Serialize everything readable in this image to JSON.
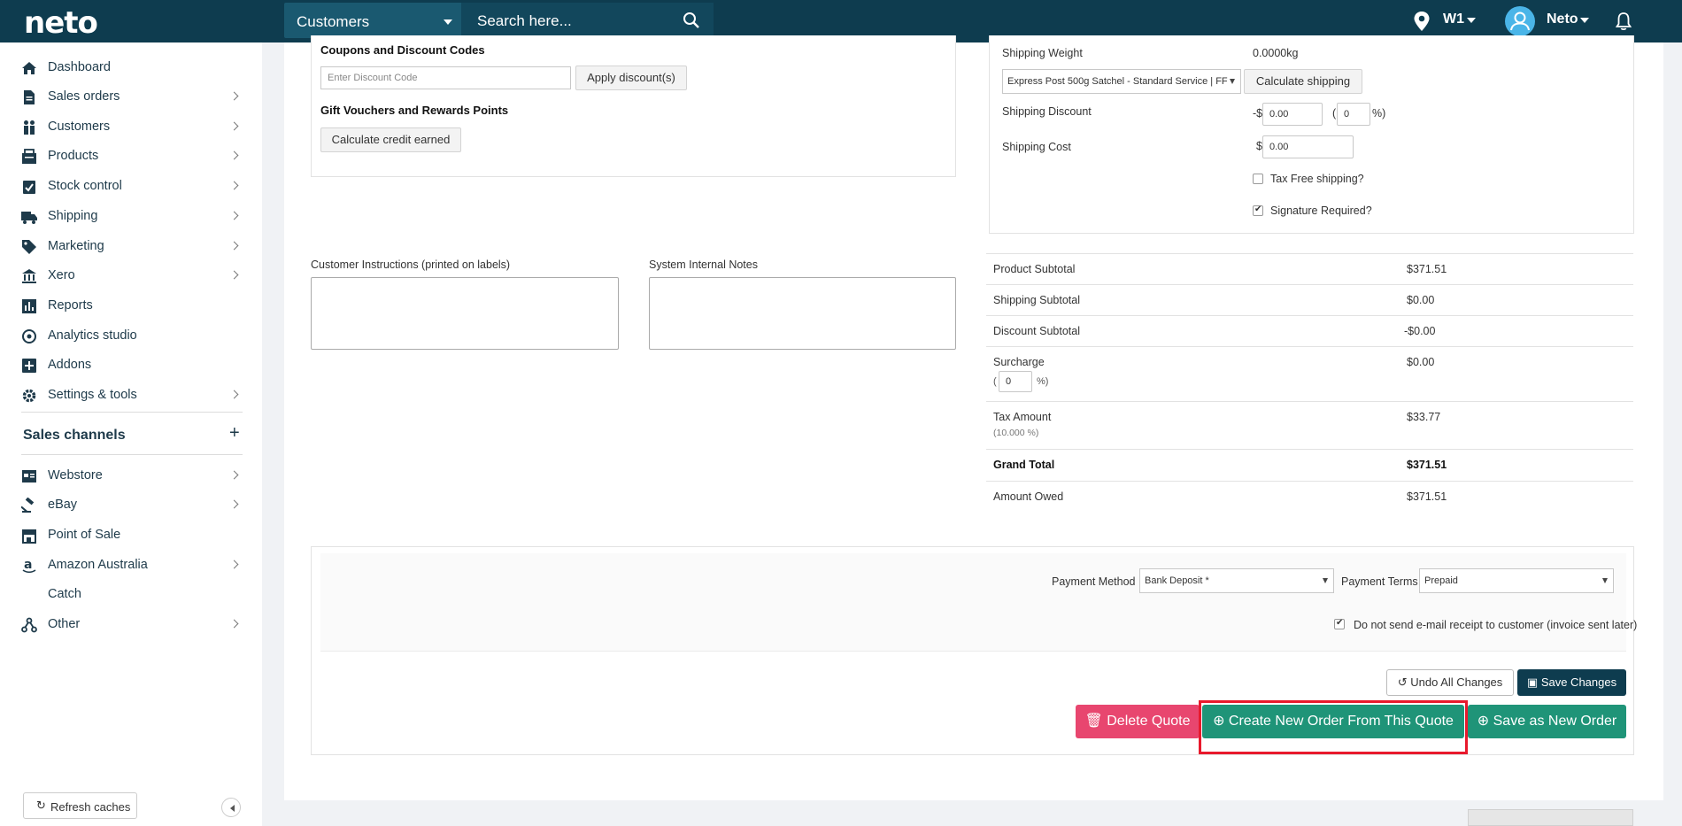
{
  "topbar": {
    "logo": "neto",
    "search_scope": "Customers",
    "search_placeholder": "Search here...",
    "warehouse": "W1",
    "user": "Neto"
  },
  "sidebar": {
    "items": [
      {
        "label": "Dashboard",
        "icon": "home-icon"
      },
      {
        "label": "Sales orders",
        "icon": "document-icon"
      },
      {
        "label": "Customers",
        "icon": "users-icon"
      },
      {
        "label": "Products",
        "icon": "products-icon"
      },
      {
        "label": "Stock control",
        "icon": "clipboard-check-icon"
      },
      {
        "label": "Shipping",
        "icon": "truck-icon"
      },
      {
        "label": "Marketing",
        "icon": "tag-icon"
      },
      {
        "label": "Xero",
        "icon": "bank-icon"
      },
      {
        "label": "Reports",
        "icon": "bar-chart-icon"
      },
      {
        "label": "Analytics studio",
        "icon": "analytics-icon"
      },
      {
        "label": "Addons",
        "icon": "plus-square-icon"
      },
      {
        "label": "Settings & tools",
        "icon": "gear-icon"
      }
    ],
    "sales_channels_heading": "Sales channels",
    "channels": [
      {
        "label": "Webstore",
        "icon": "webstore-icon"
      },
      {
        "label": "eBay",
        "icon": "gavel-icon"
      },
      {
        "label": "Point of Sale",
        "icon": "store-icon"
      },
      {
        "label": "Amazon Australia",
        "icon": "amazon-icon"
      },
      {
        "label": "Catch",
        "icon": "catch-icon"
      },
      {
        "label": "Other",
        "icon": "network-icon"
      }
    ],
    "refresh_label": "Refresh caches"
  },
  "coupons": {
    "title": "Coupons and Discount Codes",
    "placeholder": "Enter Discount Code",
    "apply_label": "Apply discount(s)",
    "gift_title": "Gift Vouchers and Rewards Points",
    "credit_label": "Calculate credit earned"
  },
  "shipping": {
    "weight_label": "Shipping Weight",
    "weight_value": "0.0000kg",
    "method": "Express Post 500g Satchel - Standard Service | FF",
    "calc_label": "Calculate shipping",
    "discount_label": "Shipping Discount",
    "discount_prefix": "-$",
    "discount_value": "0.00",
    "discount_pct": "0",
    "cost_label": "Shipping Cost",
    "cost_prefix": "$",
    "cost_value": "0.00",
    "tax_free_label": "Tax Free shipping?",
    "signature_label": "Signature Required?"
  },
  "notes": {
    "customer_label": "Customer Instructions (printed on labels)",
    "internal_label": "System Internal Notes"
  },
  "totals": {
    "product_subtotal": {
      "label": "Product Subtotal",
      "value": "$371.51"
    },
    "shipping_subtotal": {
      "label": "Shipping Subtotal",
      "value": "$0.00"
    },
    "discount_subtotal": {
      "label": "Discount Subtotal",
      "value": "-$0.00"
    },
    "surcharge": {
      "label": "Surcharge",
      "value": "$0.00",
      "pct": "0"
    },
    "tax": {
      "label": "Tax Amount",
      "rate": "(10.000 %)",
      "value": "$33.77"
    },
    "grand_total": {
      "label": "Grand Total",
      "value": "$371.51"
    },
    "amount_owed": {
      "label": "Amount Owed",
      "value": "$371.51"
    }
  },
  "payment": {
    "method_label": "Payment Method",
    "method_value": "Bank Deposit *",
    "terms_label": "Payment Terms",
    "terms_value": "Prepaid",
    "no_email_label": "Do not send e-mail receipt to customer (invoice sent later)"
  },
  "actions": {
    "undo": "Undo All Changes",
    "save_changes": "Save Changes",
    "delete": "Delete Quote",
    "create_order": "Create New Order From This Quote",
    "save_new": "Save as New Order"
  },
  "colors": {
    "topbar": "#0e3c4f",
    "delete": "#e8466f",
    "green": "#1f9478",
    "highlight": "#e8192c"
  }
}
